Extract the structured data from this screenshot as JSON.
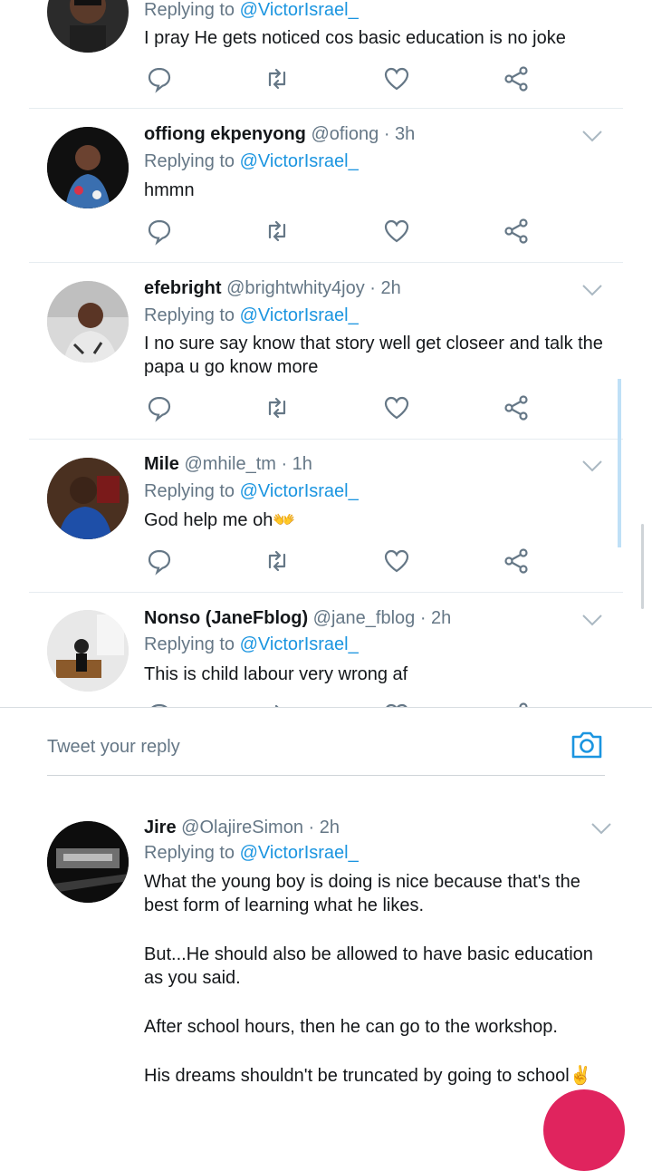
{
  "replies": [
    {
      "name": "",
      "handle": "",
      "time": "",
      "replying_label": "Replying to",
      "mention": "@VictorIsrael_",
      "text": "I pray He gets noticed cos basic education is no joke"
    },
    {
      "name": "offiong ekpenyong",
      "handle": "@ofiong",
      "time": "· 3h",
      "replying_label": "Replying to",
      "mention": "@VictorIsrael_",
      "text": "hmmn"
    },
    {
      "name": "efebright",
      "handle": "@brightwhity4joy",
      "time": "· 2h",
      "replying_label": "Replying to",
      "mention": "@VictorIsrael_",
      "text": "I no sure say know that story well get closeer and talk the papa u go know more"
    },
    {
      "name": "Mile",
      "handle": "@mhile_tm",
      "time": "· 1h",
      "replying_label": "Replying to",
      "mention": "@VictorIsrael_",
      "text": "God help me oh👐"
    },
    {
      "name": "Nonso (JaneFblog)",
      "handle": "@jane_fblog",
      "time": "· 2h",
      "replying_label": "Replying to",
      "mention": "@VictorIsrael_",
      "text": "This is child labour very wrong af"
    }
  ],
  "compose": {
    "placeholder": "Tweet your reply"
  },
  "lower_reply": {
    "name": "Jire",
    "handle": "@OlajireSimon",
    "time": "· 2h",
    "replying_label": "Replying to",
    "mention": "@VictorIsrael_",
    "paragraphs": [
      "What the young boy is doing is nice because that's the best form of learning what he likes.",
      "But...He should also be allowed to have basic education as you said.",
      "After school hours, then he can go to the workshop.",
      "His dreams shouldn't be truncated by going to school✌️"
    ]
  },
  "colors": {
    "link": "#1b95e0",
    "muted": "#657786",
    "text": "#14171a",
    "fab": "#e0245e"
  }
}
